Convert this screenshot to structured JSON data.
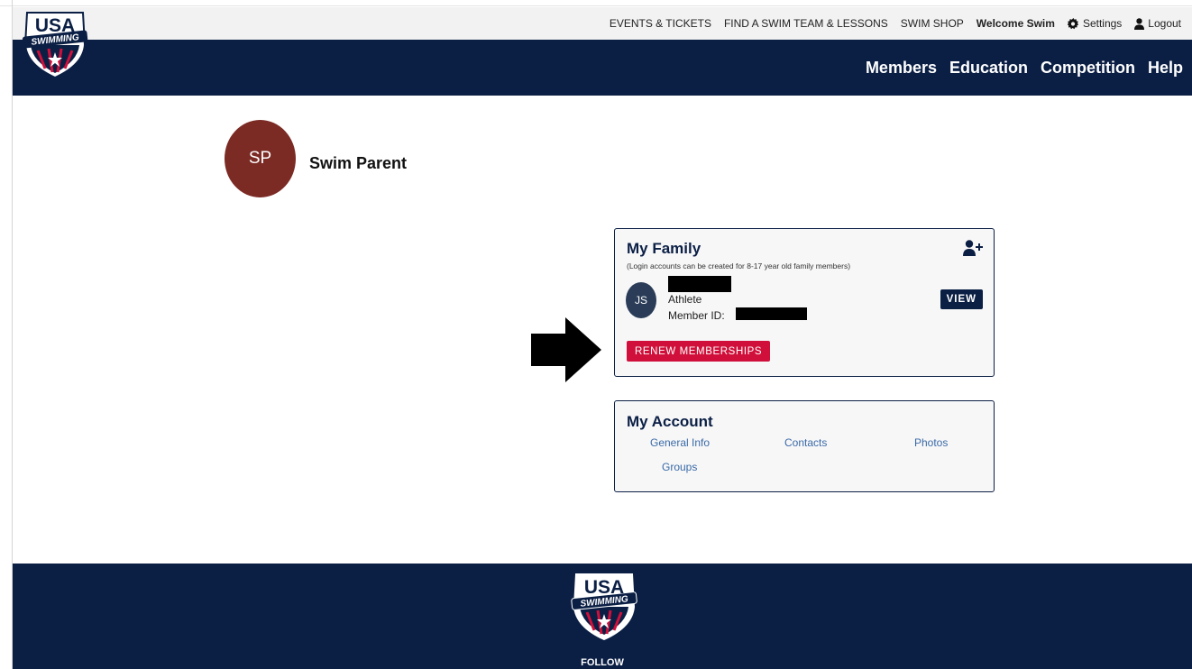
{
  "brand": {
    "logo_top": "USA",
    "logo_bottom": "SWIMMING",
    "navy": "#0b1f45",
    "red": "#d0103a",
    "avatar_color": "#7b2a24"
  },
  "utility_nav": {
    "events": "EVENTS & TICKETS",
    "find_team": "FIND A SWIM TEAM & LESSONS",
    "shop": "SWIM SHOP",
    "welcome": "Welcome Swim",
    "settings": "Settings",
    "logout": "Logout"
  },
  "main_nav": {
    "items": [
      "Members",
      "Education",
      "Competition",
      "Help"
    ]
  },
  "profile": {
    "initials": "SP",
    "name": "Swim Parent"
  },
  "family_card": {
    "title": "My Family",
    "subtitle": "(Login accounts can be created for 8-17 year old family members)",
    "member": {
      "initials": "JS",
      "role": "Athlete",
      "id_label": "Member ID:"
    },
    "view_label": "VIEW",
    "renew_label": "RENEW MEMBERSHIPS"
  },
  "account_card": {
    "title": "My Account",
    "links": [
      "General Info",
      "Contacts",
      "Photos",
      "Groups"
    ]
  },
  "footer": {
    "follow": "FOLLOW"
  },
  "icons": [
    "gear-icon",
    "user-icon",
    "add-user-icon",
    "right-arrow-icon",
    "usa-swimming-logo"
  ]
}
